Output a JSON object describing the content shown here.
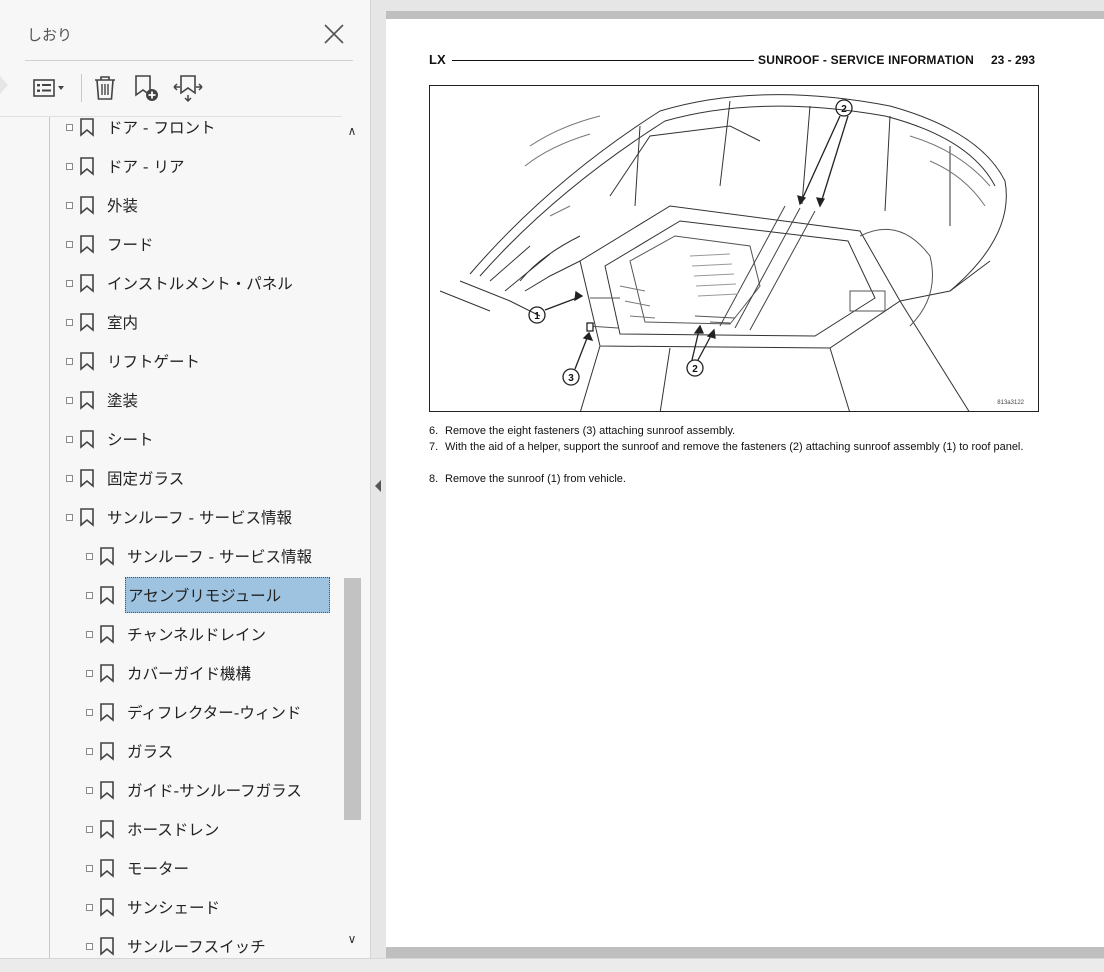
{
  "sidebar": {
    "title": "しおり",
    "toolbar": {
      "options_icon": "list-options-icon",
      "delete_icon": "trash-icon",
      "new_bookmark_icon": "new-bookmark-icon",
      "expand_bookmark_icon": "expand-bookmark-icon"
    },
    "items": [
      {
        "label": "ドア - フロント",
        "level": 1
      },
      {
        "label": "ドア - リア",
        "level": 1
      },
      {
        "label": "外装",
        "level": 1
      },
      {
        "label": "フード",
        "level": 1
      },
      {
        "label": "インストルメント・パネル",
        "level": 1
      },
      {
        "label": "室内",
        "level": 1
      },
      {
        "label": "リフトゲート",
        "level": 1
      },
      {
        "label": "塗装",
        "level": 1
      },
      {
        "label": "シート",
        "level": 1
      },
      {
        "label": "固定ガラス",
        "level": 1
      },
      {
        "label": "サンルーフ - サービス情報",
        "level": 1
      },
      {
        "label": "サンルーフ - サービス情報",
        "level": 2
      },
      {
        "label": "アセンブリモジュール",
        "level": 2,
        "selected": true
      },
      {
        "label": "チャンネルドレイン",
        "level": 2
      },
      {
        "label": "カバーガイド機構",
        "level": 2
      },
      {
        "label": "ディフレクター-ウィンド",
        "level": 2
      },
      {
        "label": "ガラス",
        "level": 2
      },
      {
        "label": "ガイド-サンルーフガラス",
        "level": 2
      },
      {
        "label": "ホースドレン",
        "level": 2
      },
      {
        "label": "モーター",
        "level": 2
      },
      {
        "label": "サンシェード",
        "level": 2
      },
      {
        "label": "サンルーフスイッチ",
        "level": 2
      }
    ],
    "selection_color": "#9ec3e0"
  },
  "page": {
    "header_left": "LX",
    "header_right": "SUNROOF - SERVICE INFORMATION",
    "page_number": "23 - 293",
    "figure": {
      "callouts": [
        "1",
        "2",
        "2",
        "3"
      ],
      "code": "813a3122"
    },
    "steps": [
      {
        "num": "6.",
        "text": "Remove the eight fasteners (3) attaching sunroof assembly."
      },
      {
        "num": "7.",
        "text": "With the aid of a helper, support the sunroof and remove the fasteners (2) attaching sunroof assembly (1) to roof panel."
      },
      {
        "num": "8.",
        "text": "Remove the sunroof (1) from vehicle."
      }
    ]
  }
}
